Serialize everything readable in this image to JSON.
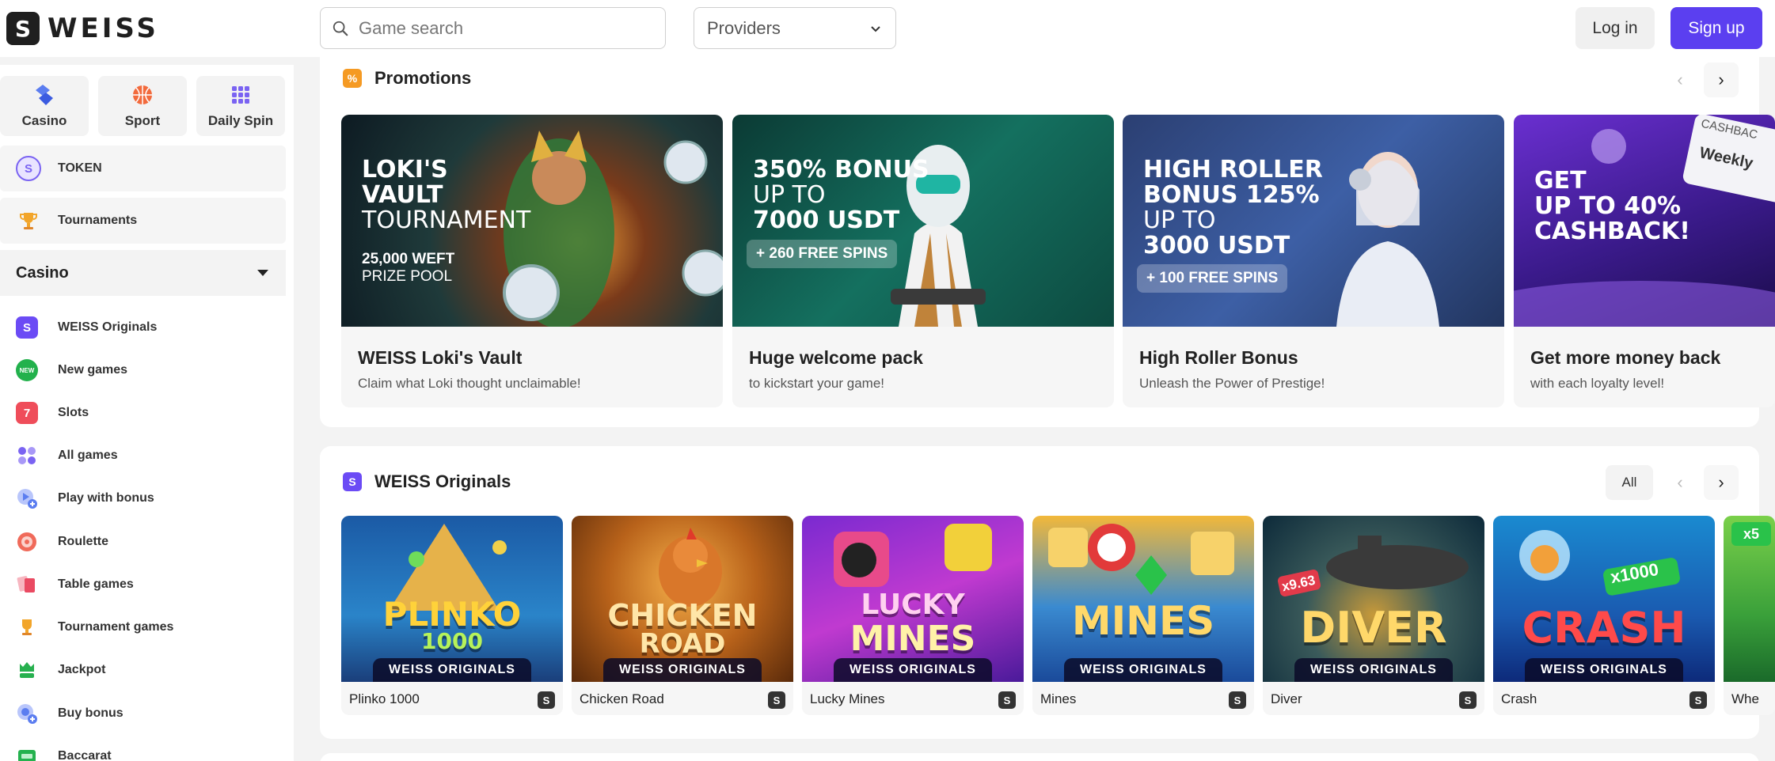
{
  "header": {
    "logo_mark": "S",
    "logo_text": "WEISS",
    "search_placeholder": "Game search",
    "providers_label": "Providers",
    "login_label": "Log in",
    "signup_label": "Sign up"
  },
  "sidebar": {
    "quick": [
      {
        "label": "Casino",
        "icon": "casino-chip-icon"
      },
      {
        "label": "Sport",
        "icon": "basketball-icon"
      },
      {
        "label": "Daily Spin",
        "icon": "spin-grid-icon"
      }
    ],
    "token_label": "TOKEN",
    "tournaments_label": "Tournaments",
    "casino_heading": "Casino",
    "items": [
      {
        "label": "WEISS Originals",
        "icon": "weiss-originals-icon",
        "color": "#6b4bf5"
      },
      {
        "label": "New games",
        "icon": "new-badge-icon",
        "color": "#22b14c"
      },
      {
        "label": "Slots",
        "icon": "slot-machine-icon",
        "color": "#ef4d5a"
      },
      {
        "label": "All games",
        "icon": "all-games-grid-icon",
        "color": "#7a63f2"
      },
      {
        "label": "Play with bonus",
        "icon": "bonus-icon",
        "color": "#6a86f5"
      },
      {
        "label": "Roulette",
        "icon": "roulette-icon",
        "color": "#f06a5a"
      },
      {
        "label": "Table games",
        "icon": "cards-icon",
        "color": "#ea4a62"
      },
      {
        "label": "Tournament games",
        "icon": "trophy-icon",
        "color": "#f2a52a"
      },
      {
        "label": "Jackpot",
        "icon": "jackpot-icon",
        "color": "#27b04f"
      },
      {
        "label": "Buy bonus",
        "icon": "buy-bonus-icon",
        "color": "#5b7df0"
      },
      {
        "label": "Baccarat",
        "icon": "baccarat-icon",
        "color": "#24b24e"
      }
    ]
  },
  "promotions": {
    "title": "Promotions",
    "cards": [
      {
        "art_line1": "LOKI'S",
        "art_line2": "VAULT",
        "art_line3": "TOURNAMENT",
        "art_sub1": "25,000 WEFT",
        "art_sub2": "PRIZE POOL",
        "title": "WEISS Loki's Vault",
        "desc": "Claim what Loki thought unclaimable!"
      },
      {
        "art_line1": "350% BONUS",
        "art_line2": "UP TO",
        "art_line3": "7000 USDT",
        "pill": "+ 260 FREE SPINS",
        "title": "Huge welcome pack",
        "desc": "to kickstart your game!"
      },
      {
        "art_line1": "HIGH ROLLER",
        "art_line2": "BONUS 125%",
        "art_line3": "UP TO",
        "art_line4": "3000 USDT",
        "pill": "+ 100 FREE SPINS",
        "title": "High Roller Bonus",
        "desc": "Unleash the Power of Prestige!"
      },
      {
        "art_line1": "GET",
        "art_line2": "UP TO 40%",
        "art_line3": "CASHBACK!",
        "tag1": "CASHBAC",
        "tag2": "Weekly",
        "title": "Get more money back",
        "desc": "with each loyalty level!"
      }
    ]
  },
  "originals": {
    "title": "WEISS Originals",
    "all_label": "All",
    "band_label": "WEISS ORIGINALS",
    "mark": "S",
    "games": [
      {
        "name": "Plinko 1000",
        "art1": "PLINKO",
        "art2": "1000"
      },
      {
        "name": "Chicken Road",
        "art1": "CHICKEN",
        "art2": "ROAD"
      },
      {
        "name": "Lucky Mines",
        "art1": "LUCKY",
        "art2": "MINES"
      },
      {
        "name": "Mines",
        "art1": "MINES",
        "art2": ""
      },
      {
        "name": "Diver",
        "art1": "DIVER",
        "art2": "x9.63"
      },
      {
        "name": "Crash",
        "art1": "CRASH",
        "art2": "x1000"
      },
      {
        "name": "Whe",
        "art1": "",
        "art2": "x5"
      }
    ]
  },
  "colors": {
    "accent": "#5b3ff0",
    "promo_badge": "#f59a23",
    "originals_badge": "#6b4bf5"
  }
}
